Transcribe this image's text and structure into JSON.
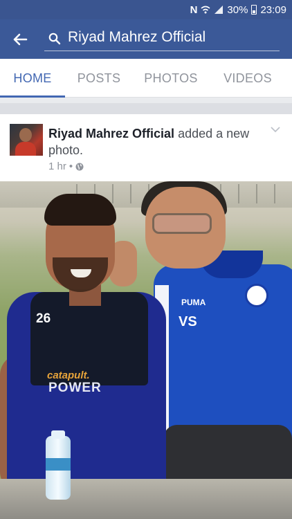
{
  "status_bar": {
    "notification_icon": "N",
    "battery_percent": "30%",
    "time": "23:09"
  },
  "header": {
    "search_text": "Riyad Mahrez Official"
  },
  "tabs": [
    {
      "label": "HOME",
      "active": true
    },
    {
      "label": "POSTS",
      "active": false
    },
    {
      "label": "PHOTOS",
      "active": false
    },
    {
      "label": "VIDEOS",
      "active": false
    }
  ],
  "post": {
    "author": "Riyad Mahrez Official",
    "action": " added a new photo.",
    "time": "1 hr",
    "separator": "•",
    "privacy_icon": "globe-icon",
    "photo": {
      "jersey_number": "26",
      "sponsor": "catapult.",
      "sponsor2": "POWER",
      "shirt_initials": "VS",
      "brand": "PUMA"
    }
  },
  "colors": {
    "header_bg": "#3b5998",
    "tab_active": "#4267b2",
    "tab_inactive": "#90949c"
  }
}
